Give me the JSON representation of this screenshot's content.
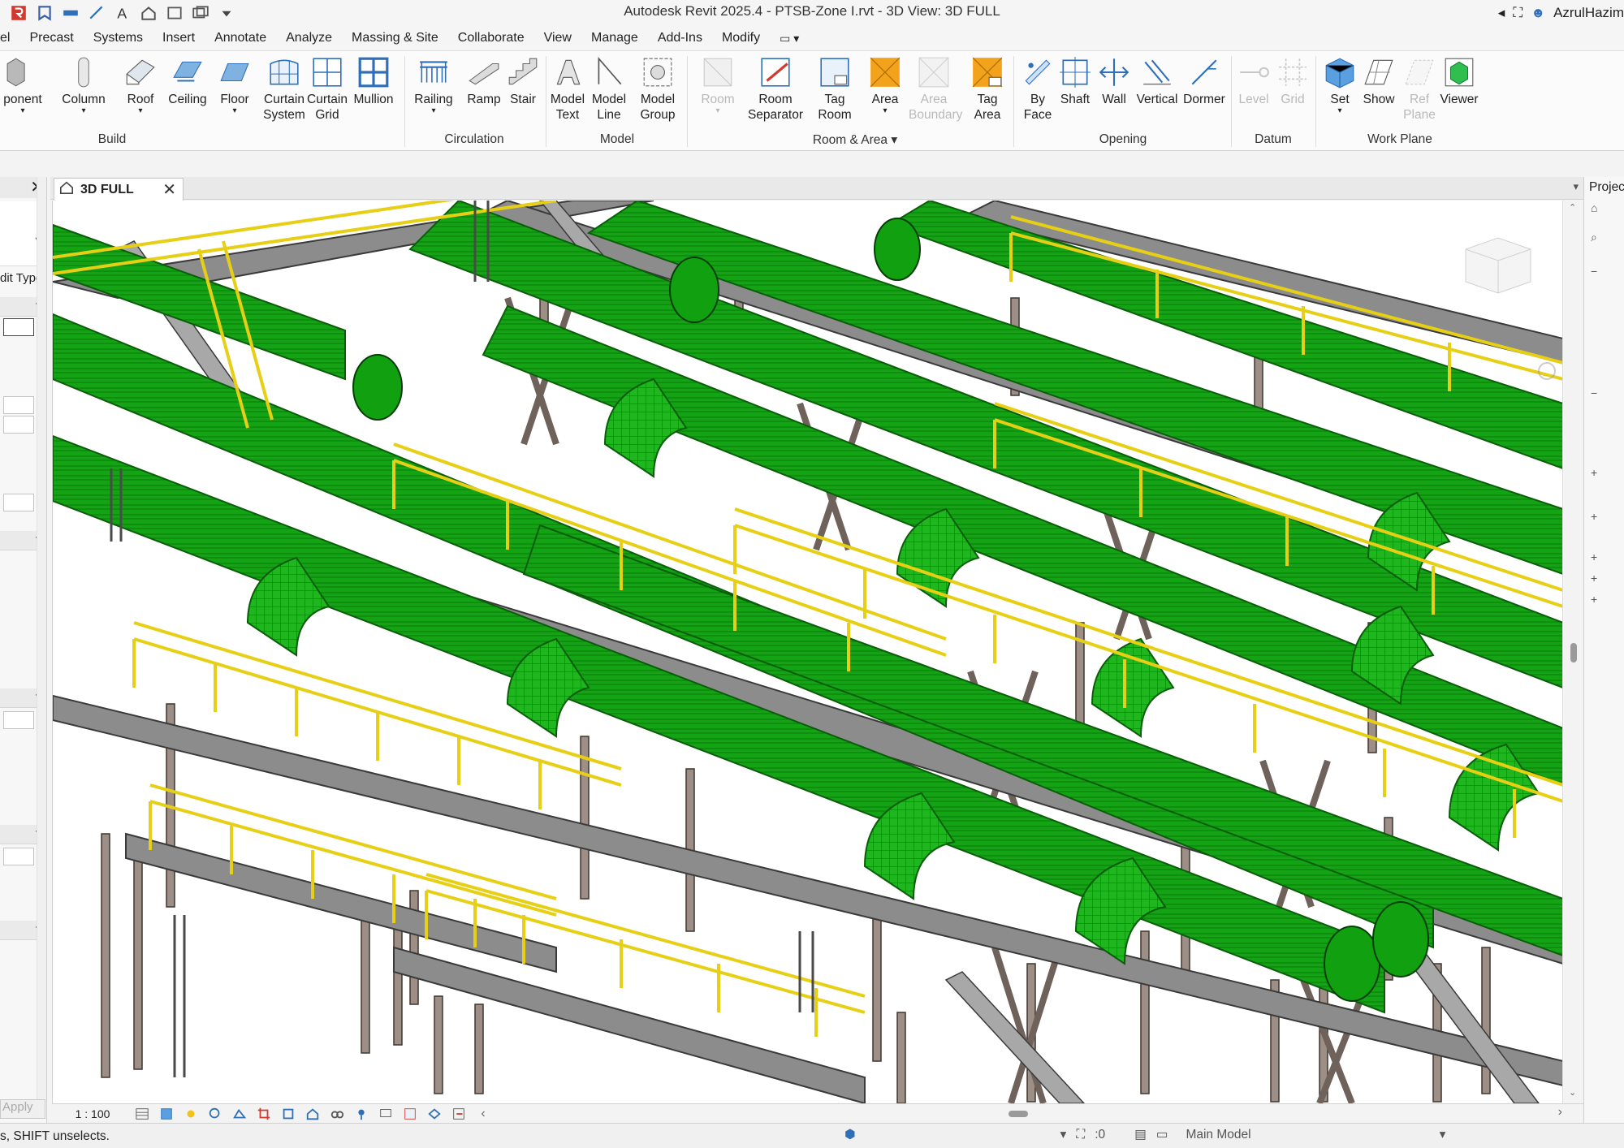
{
  "window": {
    "title": "Autodesk Revit 2025.4 - PTSB-Zone I.rvt - 3D View: 3D FULL",
    "user": "AzrulHazim"
  },
  "ribbon_tabs": [
    "el",
    "Precast",
    "Systems",
    "Insert",
    "Annotate",
    "Analyze",
    "Massing & Site",
    "Collaborate",
    "View",
    "Manage",
    "Add-Ins",
    "Modify"
  ],
  "ribbon": {
    "buttons": {
      "component": "ponent",
      "column": "Column",
      "roof": "Roof",
      "ceiling": "Ceiling",
      "floor": "Floor",
      "curtain_system": "Curtain System",
      "curtain_grid": "Curtain Grid",
      "mullion": "Mullion",
      "railing": "Railing",
      "ramp": "Ramp",
      "stair": "Stair",
      "model_text": "Model Text",
      "model_line": "Model Line",
      "model_group": "Model Group",
      "room": "Room",
      "room_separator": "Room Separator",
      "tag_room": "Tag Room",
      "area": "Area",
      "area_boundary": "Area Boundary",
      "tag_area": "Tag Area",
      "by_face": "By Face",
      "shaft": "Shaft",
      "wall": "Wall",
      "vertical": "Vertical",
      "dormer": "Dormer",
      "level": "Level",
      "grid": "Grid",
      "set": "Set",
      "show": "Show",
      "ref_plane": "Ref Plane",
      "viewer": "Viewer"
    },
    "groups": {
      "build": "Build",
      "circulation": "Circulation",
      "model": "Model",
      "room_area": "Room & Area ▾",
      "opening": "Opening",
      "datum": "Datum",
      "work_plane": "Work Plane"
    }
  },
  "properties": {
    "edit_type": "dit Type",
    "apply": "Apply"
  },
  "view_tab": {
    "label": "3D FULL"
  },
  "project_browser": {
    "title": "Project"
  },
  "view_bar": {
    "scale": "1 : 100"
  },
  "status": {
    "text": "s, SHIFT unselects.",
    "count": ":0",
    "model": "Main Model"
  },
  "colors": {
    "pipe_green": "#14a314",
    "railing_yellow": "#f0dc1e",
    "steel_gray": "#8c8c8c",
    "column_brown": "#9e8f86",
    "ribbon_blue": "#2f7fd0",
    "area_orange": "#f2a21b"
  }
}
